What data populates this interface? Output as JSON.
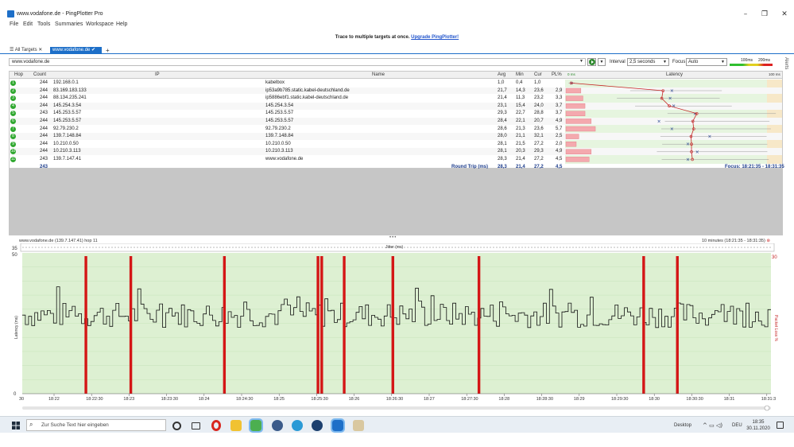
{
  "window": {
    "title": "www.vodafone.de - PingPlotter Pro",
    "minimize": "–",
    "maximize": "❐",
    "close": "✕"
  },
  "menu": [
    "File",
    "Edit",
    "Tools",
    "Summaries",
    "Workspace",
    "Help"
  ],
  "promo": {
    "text": "Trace to multiple targets at once.",
    "link": "Upgrade PingPlotter!"
  },
  "tabs": {
    "all": "All Targets",
    "active": "www.vodafone.de",
    "add": "+"
  },
  "toolbar": {
    "target": "www.vodafone.de",
    "interval_label": "Interval",
    "interval_value": "2,5 seconds",
    "focus_label": "Focus",
    "focus_value": "Auto",
    "scale_100": "100ms",
    "scale_200": "200ms",
    "alerts": "Alerts"
  },
  "grid": {
    "headers": {
      "hop": "Hop",
      "count": "Count",
      "ip": "IP",
      "name": "Name",
      "avg": "Avg",
      "min": "Min",
      "cur": "Cur",
      "pl": "PL%",
      "latency": "Latency",
      "zero": "0 ms",
      "max": "100 ms"
    },
    "rows": [
      {
        "hop": "1",
        "count": "244",
        "ip": "192.168.0.1",
        "name": "kabelbox",
        "avg": "1,0",
        "min": "0,4",
        "cur": "1,0",
        "pl": ""
      },
      {
        "hop": "2",
        "count": "244",
        "ip": "83.169.183.133",
        "name": "ip53a9b785.static.kabel-deutschland.de",
        "avg": "21,7",
        "min": "14,3",
        "cur": "23,6",
        "pl": "2,9"
      },
      {
        "hop": "3",
        "count": "244",
        "ip": "88.134.235.241",
        "name": "ip5886ebf1.static.kabel-deutschland.de",
        "avg": "21,4",
        "min": "11,3",
        "cur": "23,2",
        "pl": "3,3"
      },
      {
        "hop": "4",
        "count": "244",
        "ip": "145.254.3.54",
        "name": "145.254.3.54",
        "avg": "23,1",
        "min": "15,4",
        "cur": "24,0",
        "pl": "3,7"
      },
      {
        "hop": "5",
        "count": "243",
        "ip": "145.253.5.57",
        "name": "145.253.5.57",
        "avg": "29,3",
        "min": "22,7",
        "cur": "28,8",
        "pl": "3,7"
      },
      {
        "hop": "6",
        "count": "244",
        "ip": "145.253.5.57",
        "name": "145.253.5.57",
        "avg": "28,4",
        "min": "22,1",
        "cur": "20,7",
        "pl": "4,9"
      },
      {
        "hop": "7",
        "count": "244",
        "ip": "92.79.230.2",
        "name": "92.79.230.2",
        "avg": "28,6",
        "min": "21,3",
        "cur": "23,6",
        "pl": "5,7"
      },
      {
        "hop": "8",
        "count": "244",
        "ip": "139.7.148.84",
        "name": "139.7.148.84",
        "avg": "28,0",
        "min": "21,1",
        "cur": "32,1",
        "pl": "2,5"
      },
      {
        "hop": "9",
        "count": "244",
        "ip": "10.210.0.50",
        "name": "10.210.0.50",
        "avg": "28,1",
        "min": "21,5",
        "cur": "27,2",
        "pl": "2,0"
      },
      {
        "hop": "10",
        "count": "244",
        "ip": "10.210.3.113",
        "name": "10.210.3.113",
        "avg": "28,1",
        "min": "20,3",
        "cur": "29,3",
        "pl": "4,9"
      },
      {
        "hop": "11",
        "count": "243",
        "ip": "139.7.147.41",
        "name": "www.vodafone.de",
        "avg": "28,3",
        "min": "21,4",
        "cur": "27,2",
        "pl": "4,5"
      }
    ],
    "summary": {
      "count": "243",
      "label": "Round Trip (ms)",
      "avg": "28,3",
      "min": "21,4",
      "cur": "27,2",
      "pl": "4,5",
      "focus": "Focus: 18:21:35 - 18:31:35"
    }
  },
  "graph": {
    "title_left": "www.vodafone.de (139.7.147.41) hop 11",
    "title_right": "10 minutes (18:21:35 - 18:31:35)",
    "jitter_label": "Jitter (ms)",
    "jitter_max": "35",
    "y_label": "Latency (ms)",
    "y_right_label": "Packet Loss %",
    "y_top": "50",
    "y_zero": "0",
    "pl_max": "30",
    "x_first": "30",
    "x_labels": [
      "18:22",
      "18:22:30",
      "18:23",
      "18:23:30",
      "18:24",
      "18:24:30",
      "18:25",
      "18:25:30",
      "18:26",
      "18:26:30",
      "18:27",
      "18:27:30",
      "18:28",
      "18:28:30",
      "18:29",
      "18:29:30",
      "18:30",
      "18:30:30",
      "18:31",
      "18:31:3"
    ],
    "loss_markers_fraction": [
      0.085,
      0.145,
      0.27,
      0.395,
      0.4,
      0.43,
      0.495,
      0.61,
      0.83,
      0.875
    ]
  },
  "taskbar": {
    "search_placeholder": "Zur Suche Text hier eingeben",
    "desktop": "Desktop",
    "lang": "DEU",
    "time": "18:35",
    "date": "30.11.2020"
  }
}
